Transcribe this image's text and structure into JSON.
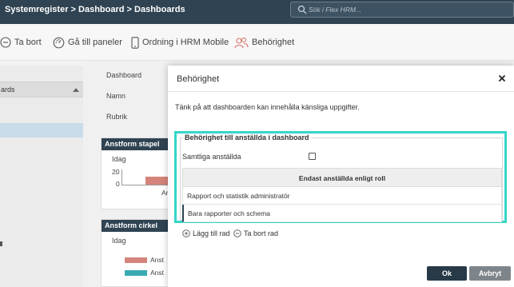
{
  "header": {
    "breadcrumb": "Systemregister > Dashboard > Dashboards",
    "search_placeholder": "Sök i Flex HRM..."
  },
  "toolbar": {
    "items": [
      {
        "label": "Ta bort",
        "icon": "minus-circle-icon"
      },
      {
        "label": "Gå till paneler",
        "icon": "dashboard-gauge-icon"
      },
      {
        "label": "Ordning i HRM Mobile",
        "icon": "mobile-phone-icon"
      },
      {
        "label": "Behörighet",
        "icon": "users-icon"
      }
    ]
  },
  "sidebar": {
    "header_label": "ards"
  },
  "form": {
    "fields": [
      "Dashboard",
      "Namn",
      "Rubrik"
    ]
  },
  "cards": [
    {
      "title": "Anstform stapel",
      "label": "Idag",
      "ticks": [
        "20",
        "0"
      ],
      "partial_label": "Ar"
    },
    {
      "title": "Anstform cirkel",
      "label": "Idag",
      "legend": [
        "Anst",
        "Anst"
      ]
    }
  ],
  "dialog": {
    "title": "Behörighet",
    "message": "Tänk på att dashboarden kan innehålla känsliga uppgifter.",
    "fieldset_legend": "Behörighet till anställda i dashboard",
    "all_employees_label": "Samtliga anställda",
    "all_employees_checked": false,
    "table": {
      "header": "Endast anställda enligt roll",
      "rows": [
        "Rapport och statistik administratör",
        "Bara rapporter och schema"
      ]
    },
    "add_row_label": "Lägg till rad",
    "remove_row_label": "Ta bort rad",
    "ok_label": "Ok",
    "cancel_label": "Avbryt"
  },
  "colors": {
    "topbar": "#2f4352",
    "highlight": "#34d6c8",
    "bar_salmon": "#d4847a",
    "bar_teal": "#3aaab0"
  }
}
